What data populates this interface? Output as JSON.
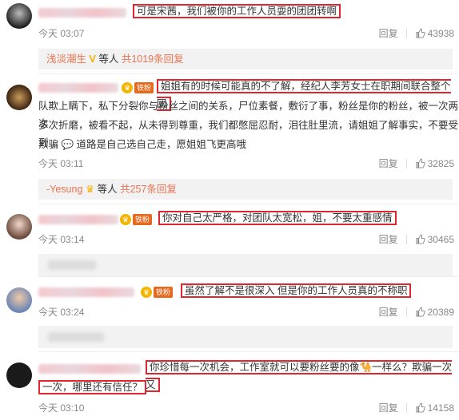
{
  "comments": [
    {
      "text": "可是宋茜，我们被你的工作人员耍的团团转啊",
      "time": "今天 03:07",
      "reply_label": "回复",
      "likes": "43938",
      "subreply": {
        "user": "浅淡潮生",
        "mid": "等人",
        "count_text": "共1019条回复"
      }
    },
    {
      "text_line1": "姐姐有的时候可能真的不了解，经纪人李芳女士在职期间联合整个团",
      "text_line2": "队欺上瞒下，私下分裂你与粉丝之间的关系，尸位素餐，敷衍了事，粉丝是你的粉丝，被一次两次",
      "text_line3": "多次折磨，被看不起，从未得到尊重，我们都憋屈忍耐，泪往肚里流，请姐姐了解事实，不要受到",
      "text_line4": "欺骗 💬 道路是自己选自己走，愿姐姐飞更高哦",
      "time": "今天 03:11",
      "reply_label": "回复",
      "likes": "32825",
      "subreply": {
        "user": "-Yesung",
        "mid": "等人",
        "count_text": "共257条回复"
      }
    },
    {
      "text": "你对自己太严格，对团队太宽松，姐，不要太重感情",
      "time": "今天 03:14",
      "reply_label": "回复",
      "likes": "30465"
    },
    {
      "text": "虽然了解不是很深入 但是你的工作人员真的不称职",
      "time": "今天 03:24",
      "reply_label": "回复",
      "likes": "20389"
    },
    {
      "text_line1": "你珍惜每一次机会，工作室就可以要粉丝要的像🐪一样么？欺骗一次又",
      "text_line2": "一次，哪里还有信任？",
      "time": "今天 03:10",
      "reply_label": "回复",
      "likes": "14158"
    }
  ],
  "badge_fan": "铁粉",
  "colors": {
    "highlight_border": "#e0262f",
    "link": "#eb7350"
  }
}
